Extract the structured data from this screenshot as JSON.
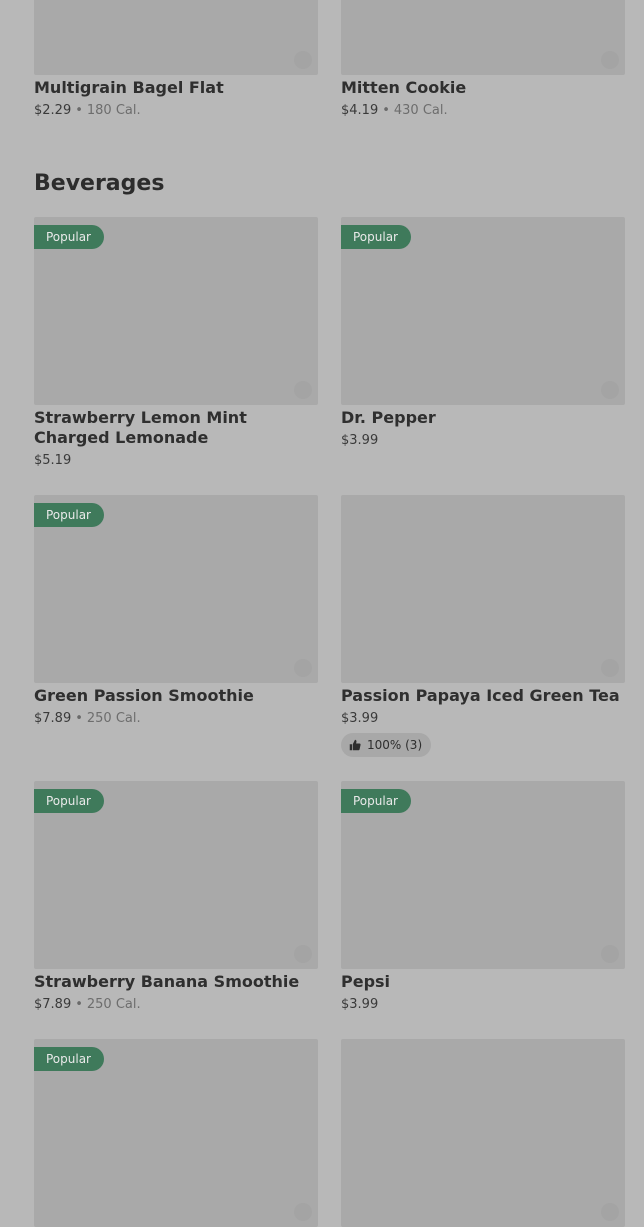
{
  "top_items": [
    {
      "name": "Multigrain Bagel Flat",
      "price": "$2.29",
      "separator": "•",
      "calories": "180 Cal."
    },
    {
      "name": "Mitten Cookie",
      "price": "$4.19",
      "separator": "•",
      "calories": "430 Cal."
    }
  ],
  "section": {
    "title": "Beverages"
  },
  "badge_label": "Popular",
  "beverages": [
    {
      "name": "Strawberry Lemon Mint Charged Lemonade",
      "price": "$5.19",
      "popular": true
    },
    {
      "name": "Dr. Pepper",
      "price": "$3.99",
      "popular": true
    },
    {
      "name": "Green Passion Smoothie",
      "price": "$7.89",
      "separator": "•",
      "calories": "250 Cal.",
      "popular": true
    },
    {
      "name": "Passion Papaya Iced Green Tea",
      "price": "$3.99",
      "popular": false,
      "rating": "100% (3)",
      "rating_icon": "thumbs-up-icon"
    },
    {
      "name": "Strawberry Banana Smoothie",
      "price": "$7.89",
      "separator": "•",
      "calories": "250 Cal.",
      "popular": true
    },
    {
      "name": "Pepsi",
      "price": "$3.99",
      "popular": true
    },
    {
      "popular": true
    },
    {
      "popular": false
    }
  ],
  "colors": {
    "badge": "#3f7a5b",
    "background": "#b8b8b8",
    "image_placeholder": "#a9a9a9"
  }
}
